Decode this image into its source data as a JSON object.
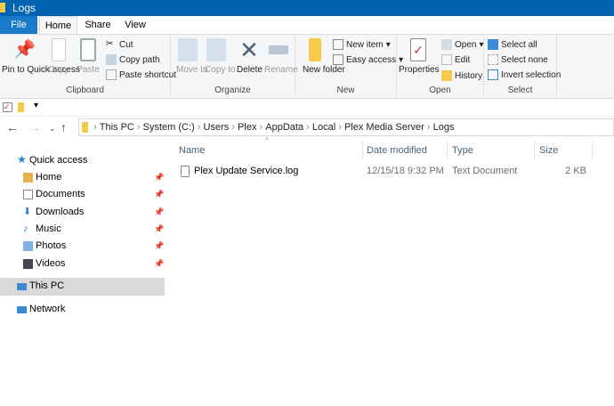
{
  "window": {
    "title": "Logs"
  },
  "tabs": [
    "File",
    "Home",
    "Share",
    "View"
  ],
  "ribbon": {
    "clipboard": {
      "label": "Clipboard",
      "pin": "Pin to Quick access",
      "copy": "Copy",
      "paste": "Paste",
      "cut": "Cut",
      "copy_path": "Copy path",
      "paste_shortcut": "Paste shortcut"
    },
    "organize": {
      "label": "Organize",
      "move_to": "Move to",
      "copy_to": "Copy to",
      "delete": "Delete",
      "rename": "Rename"
    },
    "new": {
      "label": "New",
      "new_folder": "New folder",
      "new_item": "New item",
      "easy_access": "Easy access"
    },
    "open": {
      "label": "Open",
      "properties": "Properties",
      "open": "Open",
      "edit": "Edit",
      "history": "History"
    },
    "select": {
      "label": "Select",
      "select_all": "Select all",
      "select_none": "Select none",
      "invert": "Invert selection"
    }
  },
  "breadcrumb": [
    "This PC",
    "System (C:)",
    "Users",
    "Plex",
    "AppData",
    "Local",
    "Plex Media Server",
    "Logs"
  ],
  "sidebar": {
    "quick_access": "Quick access",
    "items": [
      "Home",
      "Documents",
      "Downloads",
      "Music",
      "Photos",
      "Videos"
    ],
    "this_pc": "This PC",
    "network": "Network"
  },
  "columns": [
    "Name",
    "Date modified",
    "Type",
    "Size"
  ],
  "files": [
    {
      "name": "Plex Update Service.log",
      "date": "12/15/18 9:32 PM",
      "type": "Text Document",
      "size": "2 KB"
    }
  ]
}
